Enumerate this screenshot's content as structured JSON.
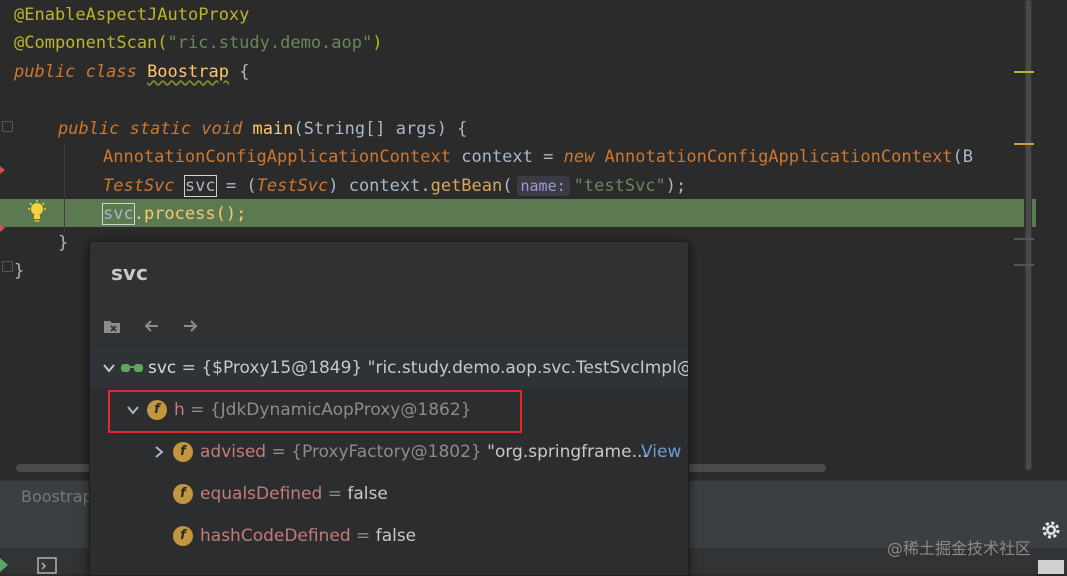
{
  "code": {
    "line1": "@EnableAspectJAutoProxy",
    "line2_ann": "@ComponentScan(",
    "line2_str": "\"ric.study.demo.aop\"",
    "line2_end": ")",
    "line3_kw": "public class ",
    "line3_cls": "Boostrap",
    "line3_end": " {",
    "line5_kw": "public static void ",
    "line5_fn": "main",
    "line5_rest": "(String[] args) {",
    "line6_type": "AnnotationConfigApplicationContext",
    "line6_mid": " context = ",
    "line6_new": "new ",
    "line6_ctor": "AnnotationConfigApplicationContext",
    "line6_tail": "(B",
    "line7_type": "TestSvc",
    "line7_var": "svc",
    "line7_eq": " = (",
    "line7_cast": "TestSvc",
    "line7_mid": ") context.",
    "line7_call": "getBean",
    "line7_paren": "(",
    "line7_hint": "name:",
    "line7_str": "\"testSvc\"",
    "line7_end": ");",
    "line8_var": "svc",
    "line8_call": ".process",
    "line8_end": "();",
    "line9": "}",
    "line10": "}"
  },
  "bottom_tab": {
    "label": "Boostrap"
  },
  "watermark": "@稀土掘金技术社区",
  "popup": {
    "title": "svc",
    "rows": [
      {
        "name": "svc",
        "eq": " = ",
        "val": "{$Proxy15@1849}",
        "str": " \"ric.study.demo.aop.svc.TestSvcImpl@"
      },
      {
        "badge": "f",
        "name": "h",
        "eq": " = ",
        "val": "{JdkDynamicAopProxy@1862}"
      },
      {
        "badge": "f",
        "name": "advised",
        "eq": " = ",
        "val": "{ProxyFactory@1802}",
        "str": " \"org.springframe...",
        "link": "View"
      },
      {
        "badge": "f",
        "name": "equalsDefined",
        "eq": " = ",
        "val": "false"
      },
      {
        "badge": "f",
        "name": "hashCodeDefined",
        "eq": " = ",
        "val": "false"
      }
    ]
  },
  "colors": {
    "exec_line": "#5c7a52",
    "highlight_box": "#e0282f",
    "field_badge": "#c3953e"
  },
  "icons": [
    "lightbulb-icon",
    "remove-watch-icon",
    "back-arrow-icon",
    "forward-arrow-icon",
    "watch-glasses-icon",
    "chevron-down-icon",
    "chevron-right-icon",
    "gear-icon",
    "terminal-icon",
    "run-icon"
  ]
}
